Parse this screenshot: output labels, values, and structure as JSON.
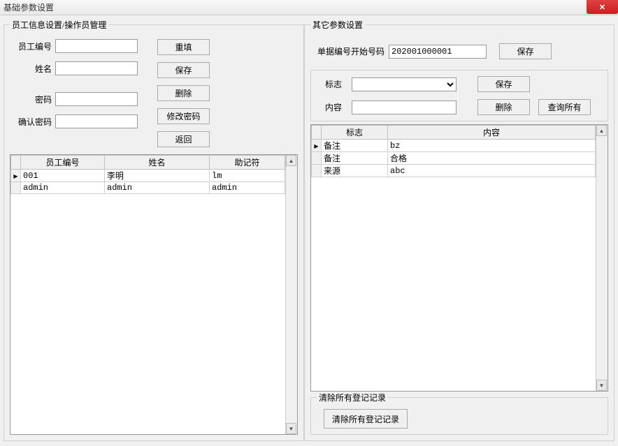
{
  "window": {
    "title": "基础参数设置"
  },
  "left": {
    "group_title": "员工信息设置/操作员管理",
    "labels": {
      "emp_no": "员工编号",
      "name": "姓名",
      "password": "密码",
      "confirm_password": "确认密码"
    },
    "values": {
      "emp_no": "",
      "name": "",
      "password": "",
      "confirm_password": ""
    },
    "buttons": {
      "refill": "重填",
      "save": "保存",
      "delete": "删除",
      "change_pw": "修改密码",
      "back": "返回"
    },
    "grid": {
      "headers": {
        "emp_no": "员工编号",
        "name": "姓名",
        "mnemonic": "助记符"
      },
      "rows": [
        {
          "emp_no": "001",
          "name": "李明",
          "mnemonic": "lm"
        },
        {
          "emp_no": "admin",
          "name": "admin",
          "mnemonic": "admin"
        }
      ]
    }
  },
  "right": {
    "group_title": "其它参数设置",
    "start_no_label": "单据编号开始号码",
    "start_no_value": "202001000001",
    "buttons": {
      "save_top": "保存",
      "save_tag": "保存",
      "delete_tag": "删除",
      "query_all": "查询所有",
      "clear_all": "清除所有登记记录"
    },
    "tag": {
      "label_sign": "标志",
      "label_content": "内容",
      "sign_value": "",
      "content_value": ""
    },
    "grid": {
      "headers": {
        "sign": "标志",
        "content": "内容"
      },
      "rows": [
        {
          "sign": "备注",
          "content": "bz"
        },
        {
          "sign": "备注",
          "content": "合格"
        },
        {
          "sign": "来源",
          "content": "abc"
        }
      ]
    },
    "clear_group_title": "清除所有登记记录"
  }
}
